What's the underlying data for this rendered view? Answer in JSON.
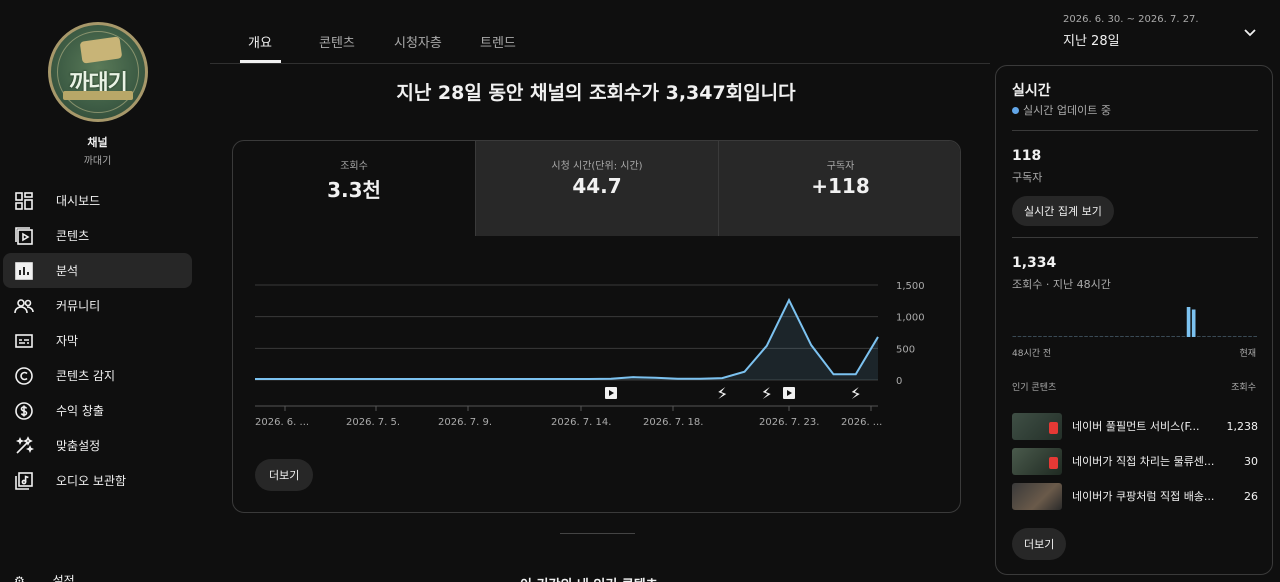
{
  "channel": {
    "title": "채널",
    "name": "까대기",
    "logo_text": "까대기"
  },
  "nav": [
    {
      "label": "대시보드",
      "icon": "dashboard-icon"
    },
    {
      "label": "콘텐츠",
      "icon": "content-icon"
    },
    {
      "label": "분석",
      "icon": "analytics-icon",
      "active": true
    },
    {
      "label": "커뮤니티",
      "icon": "community-icon"
    },
    {
      "label": "자막",
      "icon": "subtitles-icon"
    },
    {
      "label": "콘텐츠 감지",
      "icon": "copyright-icon"
    },
    {
      "label": "수익 창출",
      "icon": "monetization-icon"
    },
    {
      "label": "맞춤설정",
      "icon": "customization-icon"
    },
    {
      "label": "오디오 보관함",
      "icon": "audio-library-icon"
    }
  ],
  "bottom_nav": {
    "label": "설정"
  },
  "tabs": [
    "개요",
    "콘텐츠",
    "시청자층",
    "트렌드"
  ],
  "date": {
    "range": "2026. 6. 30. ~ 2026. 7. 27.",
    "label": "지난 28일"
  },
  "headline": "지난 28일 동안 채널의 조회수가 3,347회입니다",
  "metrics": [
    {
      "label": "조회수",
      "value": "3.3천"
    },
    {
      "label": "시청 시간(단위: 시간)",
      "value": "44.7"
    },
    {
      "label": "구독자",
      "value": "+118"
    }
  ],
  "more_label": "더보기",
  "next_section_title": "이 기간의 내 인기 콘텐츠",
  "chart_data": {
    "type": "area",
    "x_ticks": [
      "2026. 6. ...",
      "2026. 7. 5.",
      "2026. 7. 9.",
      "2026. 7. 14.",
      "2026. 7. 18.",
      "2026. 7. 23.",
      "2026. ..."
    ],
    "y_ticks": [
      "1,500",
      "1,000",
      "500",
      "0"
    ],
    "ylim": [
      0,
      1500
    ],
    "series": [
      {
        "values": [
          15,
          15,
          15,
          15,
          15,
          15,
          15,
          15,
          15,
          15,
          15,
          15,
          15,
          15,
          15,
          15,
          20,
          45,
          35,
          20,
          20,
          30,
          130,
          540,
          1260,
          550,
          90,
          90,
          680
        ]
      }
    ],
    "markers": [
      {
        "index": 16,
        "kind": "video"
      },
      {
        "index": 21,
        "kind": "shorts"
      },
      {
        "index": 23,
        "kind": "shorts"
      },
      {
        "index": 24,
        "kind": "video"
      },
      {
        "index": 27,
        "kind": "shorts"
      }
    ],
    "color": "#7cc2f0",
    "grid": true
  },
  "realtime": {
    "title": "실시간",
    "status": "실시간 업데이트 중",
    "subscribers": {
      "value": "118",
      "label": "구독자"
    },
    "button": "실시간 집계 보기",
    "views": {
      "value": "1,334",
      "label": "조회수 · 지난 48시간"
    },
    "bars": [
      0,
      0,
      0,
      0,
      0,
      0,
      0,
      0,
      0,
      0,
      0,
      0,
      0,
      0,
      0,
      0,
      0,
      0,
      0,
      0,
      0,
      0,
      0,
      0,
      0,
      0,
      0,
      0,
      0,
      0,
      0,
      0,
      0,
      0,
      24,
      22,
      0,
      0,
      0,
      0,
      0,
      0,
      0,
      0,
      0,
      0,
      0,
      0
    ],
    "axis_start": "48시간 전",
    "axis_end": "현재",
    "top_content_label": "인기 콘텐츠",
    "views_label": "조회수",
    "items": [
      {
        "title": "네이버 풀필먼트 서비스(F...",
        "views": "1,238"
      },
      {
        "title": "네이버가 직접 차리는 물류센...",
        "views": "30"
      },
      {
        "title": "네이버가 쿠팡처럼 직접 배송...",
        "views": "26"
      }
    ],
    "more": "더보기"
  }
}
